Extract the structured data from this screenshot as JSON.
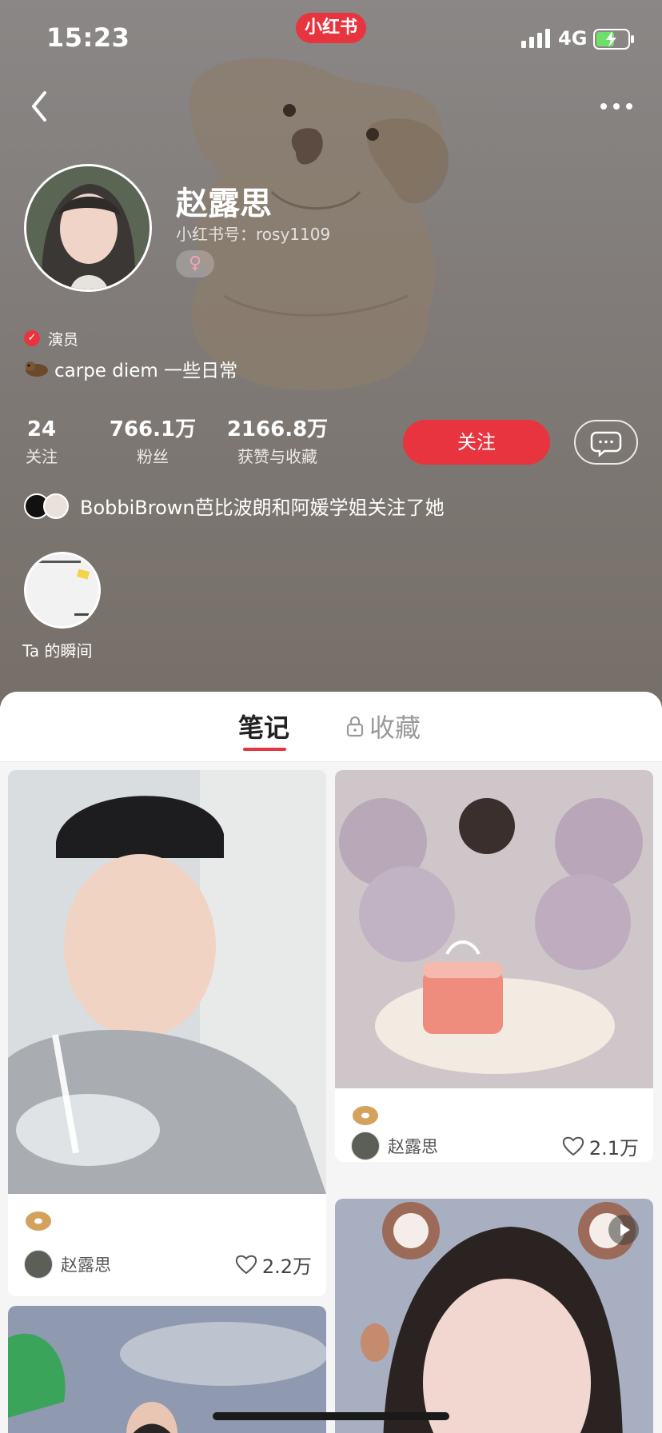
{
  "status_bar": {
    "time": "15:23",
    "network": "4G"
  },
  "brand": {
    "name": "小红书"
  },
  "profile": {
    "name": "赵露思",
    "id_label": "小红书号：rosy1109",
    "gender_symbol": "♀",
    "verification": "演员",
    "bio": "carpe diem 一些日常"
  },
  "stats": [
    {
      "value": "24",
      "label": "关注"
    },
    {
      "value": "766.1万",
      "label": "粉丝"
    },
    {
      "value": "2166.8万",
      "label": "获赞与收藏"
    }
  ],
  "actions": {
    "follow": "关注"
  },
  "mutual": {
    "text": "BobbiBrown芭比波朗和阿媛学姐关注了她"
  },
  "moment": {
    "label": "Ta 的瞬间"
  },
  "tabs": [
    {
      "label": "笔记"
    },
    {
      "label": "收藏"
    }
  ],
  "notes": [
    {
      "author": "赵露思",
      "likes": "2.2万"
    },
    {
      "author": "赵露思",
      "likes": "2.1万"
    }
  ],
  "colors": {
    "accent": "#e8343f",
    "panel": "#f5f5f5",
    "header_bg": "#7f7a77"
  },
  "icons": [
    "back-icon",
    "more-icon",
    "verified-icon",
    "message-icon",
    "lock-icon",
    "heart-icon",
    "play-icon"
  ]
}
